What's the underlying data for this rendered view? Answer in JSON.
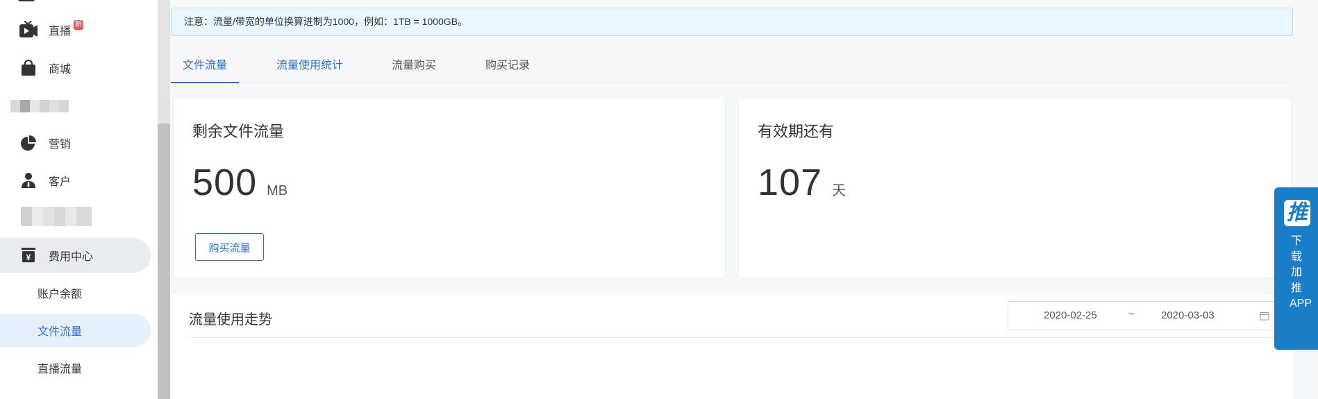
{
  "sidebar": {
    "items": [
      {
        "label": "直播",
        "icon": "tv-play-icon",
        "badge": "新"
      },
      {
        "label": "商城",
        "icon": "shopping-bag-icon"
      },
      {
        "label": "营销",
        "icon": "pie-chart-icon"
      },
      {
        "label": "客户",
        "icon": "user-icon"
      },
      {
        "label": "费用中心",
        "icon": "cashier-icon"
      }
    ],
    "sub_items": [
      {
        "label": "账户余额"
      },
      {
        "label": "文件流量"
      },
      {
        "label": "直播流量"
      }
    ]
  },
  "notice": {
    "text": "注意：流量/带宽的单位换算进制为1000，例如：1TB = 1000GB。"
  },
  "tabs": [
    {
      "label": "文件流量"
    },
    {
      "label": "流量使用统计"
    },
    {
      "label": "流量购买"
    },
    {
      "label": "购买记录"
    }
  ],
  "cards": {
    "remaining": {
      "title": "剩余文件流量",
      "value": "500",
      "unit": "MB",
      "button": "购买流量"
    },
    "validity": {
      "title": "有效期还有",
      "value": "107",
      "unit": "天"
    }
  },
  "trend": {
    "title": "流量使用走势",
    "start_date": "2020-02-25",
    "separator": "~",
    "end_date": "2020-03-03"
  },
  "app_panel": {
    "logo": "推",
    "text": "下载加推APP"
  },
  "colors": {
    "accent": "#2b6fd6",
    "badge": "#f25353",
    "app_panel": "#1a7dc8"
  }
}
